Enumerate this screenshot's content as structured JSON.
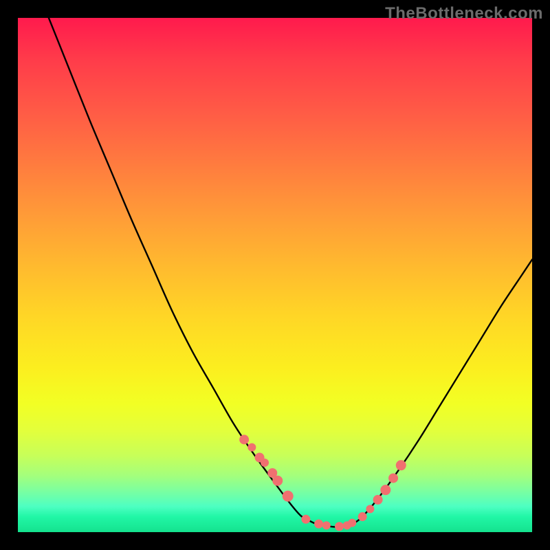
{
  "watermark": "TheBottleneck.com",
  "colors": {
    "curve": "#000000",
    "dot_fill": "#f07070",
    "dot_stroke": "#ca5050"
  },
  "chart_data": {
    "type": "line",
    "title": "",
    "xlabel": "",
    "ylabel": "",
    "xlim": [
      0,
      100
    ],
    "ylim": [
      0,
      100
    ],
    "series": [
      {
        "name": "left-branch",
        "x": [
          6,
          10,
          14,
          18,
          22,
          26,
          30,
          34,
          38,
          42,
          46,
          50,
          53,
          55,
          56.5
        ],
        "values": [
          100,
          90,
          80,
          70.5,
          61,
          52,
          43,
          35,
          28,
          21,
          15,
          9.5,
          5.5,
          3.2,
          2.3
        ]
      },
      {
        "name": "floor",
        "x": [
          56.5,
          58,
          60,
          62,
          64,
          65.5
        ],
        "values": [
          2.3,
          1.6,
          1.2,
          1.0,
          1.2,
          1.8
        ]
      },
      {
        "name": "right-branch",
        "x": [
          65.5,
          67,
          70,
          74,
          78,
          82,
          86,
          90,
          94,
          98,
          100
        ],
        "values": [
          1.8,
          3.0,
          6.5,
          12,
          18,
          24.5,
          31,
          37.5,
          44,
          50,
          53
        ]
      }
    ],
    "dots": {
      "name": "highlight-dots",
      "x": [
        44,
        45.5,
        47,
        48,
        49.5,
        50.5,
        52.5,
        56,
        58.5,
        60,
        62.5,
        64,
        65,
        67,
        68.5,
        70,
        71.5,
        73,
        74.5
      ],
      "values": [
        18,
        16.5,
        14.5,
        13.5,
        11.5,
        10,
        7,
        2.5,
        1.6,
        1.3,
        1.1,
        1.3,
        1.8,
        3.0,
        4.5,
        6.3,
        8.2,
        10.5,
        13
      ],
      "r": [
        7,
        6,
        7,
        6,
        7,
        7.5,
        8,
        6.5,
        6.5,
        6,
        6.5,
        6,
        6,
        6.5,
        6,
        7,
        7.5,
        7,
        7.5
      ]
    }
  }
}
